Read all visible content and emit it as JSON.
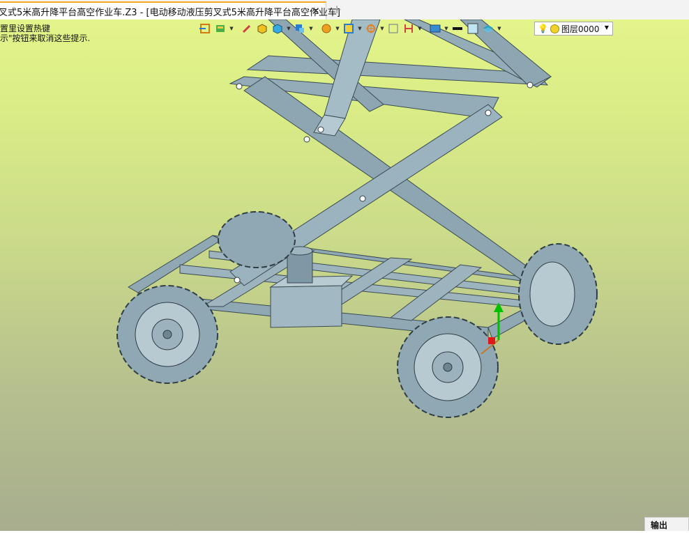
{
  "window": {
    "tab_title": "叉式5米高升降平台高空作业车.Z3 - [电动移动液压剪叉式5米高升降平台高空作业车]",
    "tab_close": "✕",
    "new_tab": "+"
  },
  "hints": {
    "line1": "置里设置热键",
    "line2": "示\"按钮来取消这些提示."
  },
  "toolbar": {
    "icons": [
      "import-icon",
      "paint-icon",
      "pencil-icon",
      "box-icon",
      "cube-icon",
      "wireframe-icon",
      "render-icon",
      "view-square-icon",
      "target-icon",
      "fit-icon",
      "dimension-icon",
      "display-icon",
      "line-color-swatch",
      "fill-color-swatch",
      "layers-icon"
    ]
  },
  "layer": {
    "current": "图层0000",
    "dot_color": "#f2d22c"
  },
  "output_tab": {
    "label": "输出"
  },
  "colors": {
    "viewport_top": "#e4f48a",
    "viewport_bottom": "#a7ad8e",
    "model_steel": "#8fa8b4",
    "tab_accent": "#f5a623"
  }
}
